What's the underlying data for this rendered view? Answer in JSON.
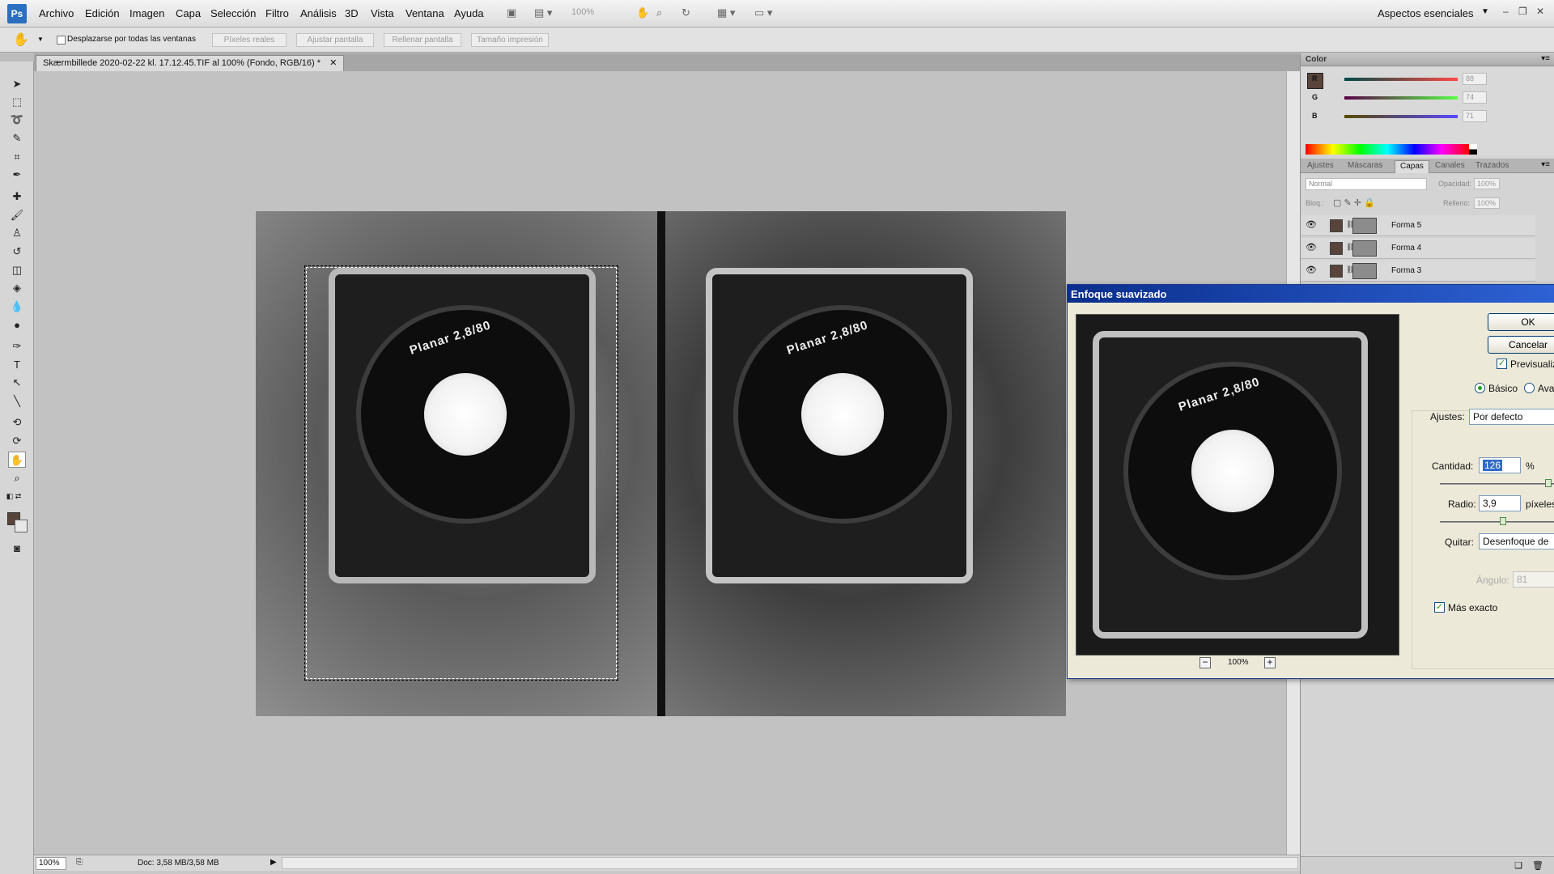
{
  "menubar": {
    "items": [
      "Archivo",
      "Edición",
      "Imagen",
      "Capa",
      "Selección",
      "Filtro",
      "Análisis",
      "3D",
      "Vista",
      "Ventana",
      "Ayuda"
    ],
    "zoom": "100%",
    "workspace": "Aspectos esenciales",
    "logo": "Ps"
  },
  "options": {
    "scroll_all_label": "Desplazarse por todas las ventanas",
    "buttons": [
      "Píxeles reales",
      "Ajustar pantalla",
      "Rellenar pantalla",
      "Tamaño impresión"
    ]
  },
  "document": {
    "tab_title": "Skærmbillede 2020-02-22 kl. 17.12.45.TIF al 100% (Fondo, RGB/16) *",
    "lens_text": "Planar 2,8/80",
    "zoom": "100%",
    "doc_info": "Doc: 3,58 MB/3,58 MB"
  },
  "color_panel": {
    "title": "Color",
    "channels": [
      {
        "label": "R",
        "value": "88"
      },
      {
        "label": "G",
        "value": "74"
      },
      {
        "label": "B",
        "value": "71"
      }
    ]
  },
  "layers_panel": {
    "tabs": [
      "Ajustes",
      "Máscaras",
      "Capas",
      "Canales",
      "Trazados"
    ],
    "active_tab": "Capas",
    "blend_mode": "Normal",
    "opacity_label": "Opacidad:",
    "opacity_value": "100%",
    "lock_label": "Bloq.:",
    "fill_label": "Relleno:",
    "fill_value": "100%",
    "layers": [
      "Forma 5",
      "Forma 4",
      "Forma 3"
    ]
  },
  "dialog": {
    "title": "Enfoque suavizado",
    "ok": "OK",
    "cancel": "Cancelar",
    "preview_label": "Previsualizar",
    "mode_basic": "Básico",
    "mode_advanced": "Avanzado",
    "settings_label": "Ajustes:",
    "settings_value": "Por defecto",
    "amount_label": "Cantidad:",
    "amount_value": "126",
    "amount_unit": "%",
    "radius_label": "Radio:",
    "radius_value": "3,9",
    "radius_unit": "píxeles",
    "remove_label": "Quitar:",
    "remove_value": "Desenfoque de",
    "angle_label": "Ángulo:",
    "angle_value": "81",
    "more_accurate_label": "Más exacto",
    "preview_zoom": "100%"
  },
  "colors": {
    "foreground": "#58443a",
    "titlebar": "#0a2e8c",
    "dialog_bg": "#ece9d8"
  }
}
